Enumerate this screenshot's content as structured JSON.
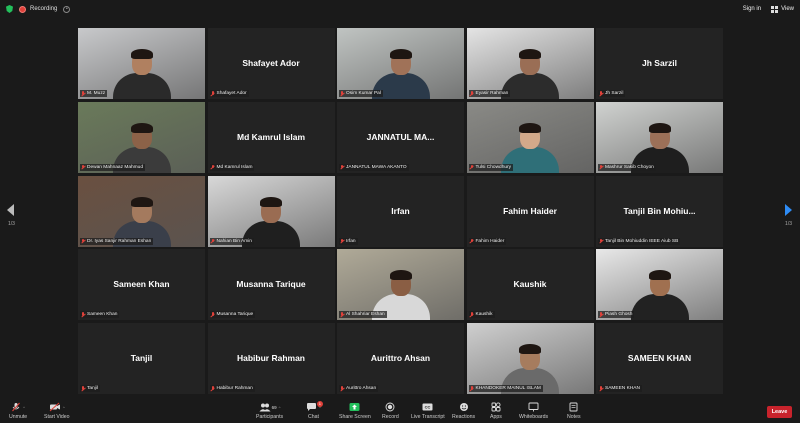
{
  "topbar": {
    "recording_label": "Recording",
    "signin_label": "Sign in",
    "view_label": "View"
  },
  "navigation": {
    "left_page": "1/3",
    "right_page": "1/3"
  },
  "tiles": [
    {
      "name": "M. Muzz",
      "big": "",
      "video": true,
      "skin": "#b08060",
      "bg": "#c8c9cb",
      "shirt": "#2a2a2a"
    },
    {
      "name": "Shafayet Ador",
      "big": "Shafayet Ador",
      "video": false
    },
    {
      "name": "Osim Kumar Pal",
      "big": "",
      "video": true,
      "skin": "#a07258",
      "bg": "#c0c4c2",
      "shirt": "#2b3a4a"
    },
    {
      "name": "Eyasir Rahman",
      "big": "",
      "video": true,
      "skin": "#9a6e55",
      "bg": "#e4e4e4",
      "shirt": "#2c2c2c"
    },
    {
      "name": "Jh Sarzil",
      "big": "Jh Sarzil",
      "video": false
    },
    {
      "name": "Dewan Mahnaaz Mahmud",
      "big": "",
      "video": true,
      "skin": "#8c6248",
      "bg": "#6a7a5a",
      "shirt": "#3b3b3b"
    },
    {
      "name": "Md Kamrul Islam",
      "big": "Md Kamrul Islam",
      "video": false
    },
    {
      "name": "JANNATUL MAWA AKANTO",
      "big": "JANNATUL  MA...",
      "video": false
    },
    {
      "name": "Tulsi Chowdhury",
      "big": "",
      "video": true,
      "skin": "#d2a98a",
      "bg": "#8a8a86",
      "shirt": "#2f6f78"
    },
    {
      "name": "Mashrur Sakib Choyon",
      "big": "",
      "video": true,
      "skin": "#9c7058",
      "bg": "#d0d2d0",
      "shirt": "#1e1e1e"
    },
    {
      "name": "Dr. Iyas Sanjir Rahman Eshan",
      "big": "",
      "video": true,
      "skin": "#a47a5e",
      "bg": "#6a5040",
      "shirt": "#3a3f4a"
    },
    {
      "name": "Nahian Bin Amin",
      "big": "",
      "video": true,
      "skin": "#9a6c52",
      "bg": "#d8d8d8",
      "shirt": "#1f1f1f",
      "active": true
    },
    {
      "name": "Irfan",
      "big": "Irfan",
      "video": false
    },
    {
      "name": "Fahim Haider",
      "big": "Fahim Haider",
      "video": false
    },
    {
      "name": "Tanjil Bin Mohiuddin IEEE Aiub SB",
      "big": "Tanjil  Bin  Mohiu...",
      "video": false
    },
    {
      "name": "Sameen Khan",
      "big": "Sameen Khan",
      "video": false
    },
    {
      "name": "Musanna Tarique",
      "big": "Musanna Tarique",
      "video": false
    },
    {
      "name": "Al Shahriar Eshan",
      "big": "",
      "video": true,
      "skin": "#8a5e44",
      "bg": "#b0aa98",
      "shirt": "#d8d8d8"
    },
    {
      "name": "Kaushik",
      "big": "Kaushik",
      "video": false
    },
    {
      "name": "Piash Ghosh",
      "big": "",
      "video": true,
      "skin": "#a07050",
      "bg": "#e8e8e8",
      "shirt": "#222222"
    },
    {
      "name": "Tanjil",
      "big": "Tanjil",
      "video": false
    },
    {
      "name": "Habibur Rahman",
      "big": "Habibur Rahman",
      "video": false
    },
    {
      "name": "Aurittro Ahsan",
      "big": "Aurittro Ahsan",
      "video": false
    },
    {
      "name": "KHANDOKER MAINUL ISLAM",
      "big": "",
      "video": true,
      "skin": "#a67c5e",
      "bg": "#cfcfcf",
      "shirt": "#6a6a6a"
    },
    {
      "name": "SAMEEN KHAN",
      "big": "SAMEEN KHAN",
      "video": false
    }
  ],
  "toolbar": {
    "unmute": "Unmute",
    "start_video": "Start Video",
    "participants": "Participants",
    "participants_count": "69",
    "chat": "Chat",
    "chat_badge": "1",
    "share_screen": "Share Screen",
    "record": "Record",
    "live_transcript": "Live Transcript",
    "reactions": "Reactions",
    "apps": "Apps",
    "whiteboards": "Whiteboards",
    "notes": "Notes",
    "leave": "Leave"
  },
  "colors": {
    "accent": "#2e8cf5",
    "leave": "#c8232c",
    "share": "#23c05c",
    "active_speaker": "#b8e84a",
    "mute": "#e0413a"
  }
}
